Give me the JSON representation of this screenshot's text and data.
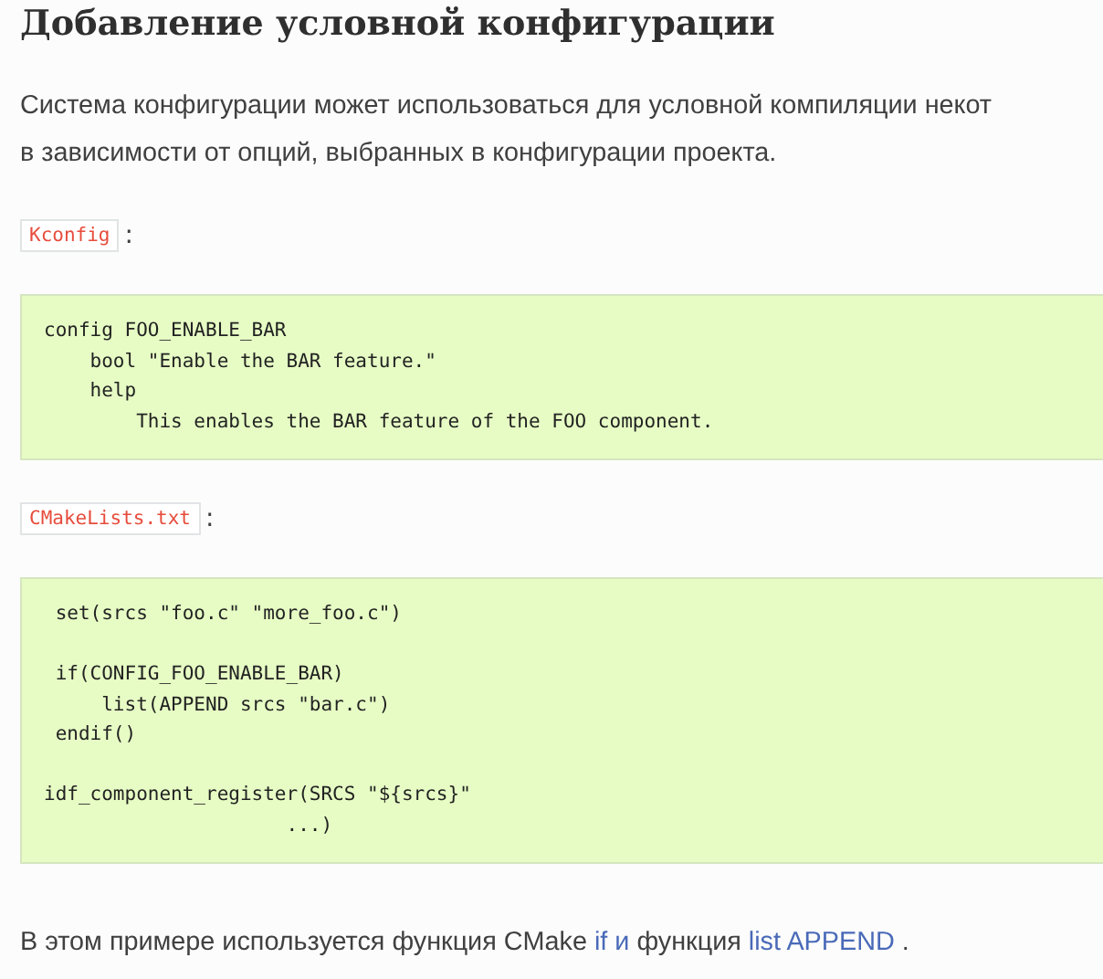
{
  "heading": "Добавление условной конфигурации",
  "intro": "Система конфигурации может использоваться для условной компиляции некот\nв зависимости от опций, выбранных в конфигурации проекта.",
  "sections": [
    {
      "file": "Kconfig",
      "suffix": ":",
      "code": "config FOO_ENABLE_BAR\n    bool \"Enable the BAR feature.\"\n    help\n        This enables the BAR feature of the FOO component."
    },
    {
      "file": "CMakeLists.txt",
      "suffix": ":",
      "code": " set(srcs \"foo.c\" \"more_foo.c\")\n\n if(CONFIG_FOO_ENABLE_BAR)\n     list(APPEND srcs \"bar.c\")\n endif()\n\nidf_component_register(SRCS \"${srcs}\"\n                     ...)"
    }
  ],
  "footer": [
    {
      "kind": "text",
      "text": "В этом примере используется функция CMake "
    },
    {
      "kind": "link",
      "text": "if и"
    },
    {
      "kind": "text",
      "text": " функция "
    },
    {
      "kind": "link",
      "text": "list APPEND"
    },
    {
      "kind": "text",
      "text": " ."
    }
  ]
}
